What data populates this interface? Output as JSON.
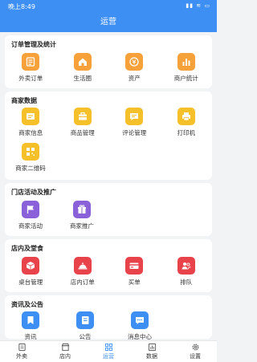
{
  "status": {
    "time": "晚上8:49",
    "icons": "▮▮ ≋ ▭"
  },
  "header": {
    "title": "运营"
  },
  "sections": [
    {
      "title": "订单管理及统计",
      "items": [
        {
          "label": "外卖订单",
          "icon": "order-list-icon",
          "color": "#f6a13a"
        },
        {
          "label": "生活圈",
          "icon": "home-icon",
          "color": "#f6a13a"
        },
        {
          "label": "资产",
          "icon": "yen-icon",
          "color": "#f6a13a"
        },
        {
          "label": "商户统计",
          "icon": "bar-chart-icon",
          "color": "#f6a13a"
        }
      ]
    },
    {
      "title": "商家数据",
      "items": [
        {
          "label": "商家信息",
          "icon": "store-info-icon",
          "color": "#f6c02b"
        },
        {
          "label": "商品管理",
          "icon": "briefcase-icon",
          "color": "#f6c02b"
        },
        {
          "label": "评论管理",
          "icon": "comment-icon",
          "color": "#f6c02b"
        },
        {
          "label": "打印机",
          "icon": "printer-icon",
          "color": "#f6c02b"
        },
        {
          "label": "商家二维码",
          "icon": "qr-code-icon",
          "color": "#f6c02b"
        }
      ]
    },
    {
      "title": "门店活动及推广",
      "items": [
        {
          "label": "商家活动",
          "icon": "flag-icon",
          "color": "#8a61d8"
        },
        {
          "label": "商家推广",
          "icon": "gift-icon",
          "color": "#8a61d8"
        }
      ]
    },
    {
      "title": "店内及堂食",
      "items": [
        {
          "label": "桌台管理",
          "icon": "cube-icon",
          "color": "#e8424b"
        },
        {
          "label": "店内订单",
          "icon": "cloche-icon",
          "color": "#e8424b"
        },
        {
          "label": "买单",
          "icon": "card-icon",
          "color": "#e8424b"
        },
        {
          "label": "排队",
          "icon": "people-icon",
          "color": "#e8424b"
        }
      ]
    },
    {
      "title": "资讯及公告",
      "items": [
        {
          "label": "资讯",
          "icon": "bookmark-icon",
          "color": "#3d8ff3"
        },
        {
          "label": "公告",
          "icon": "notebook-icon",
          "color": "#3d8ff3"
        },
        {
          "label": "消息中心",
          "icon": "chat-icon",
          "color": "#3d8ff3"
        }
      ]
    }
  ],
  "tabs": [
    {
      "label": "外卖",
      "icon": "list-tab-icon",
      "active": false
    },
    {
      "label": "店内",
      "icon": "shop-tab-icon",
      "active": false
    },
    {
      "label": "运营",
      "icon": "grid-tab-icon",
      "active": true
    },
    {
      "label": "数据",
      "icon": "chart-tab-icon",
      "active": false
    },
    {
      "label": "设置",
      "icon": "gear-tab-icon",
      "active": false
    }
  ]
}
